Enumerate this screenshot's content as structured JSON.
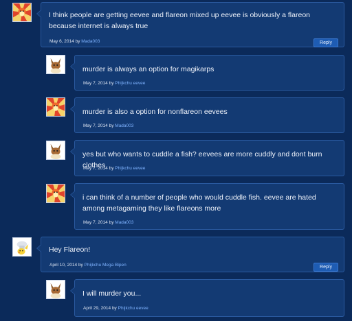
{
  "comments": [
    {
      "avatar": "flareon-avatar",
      "text": "I think people are getting eevee and flareon mixed up eevee is obviously a flareon because internet is always true",
      "date": "May 6, 2014",
      "by": "by",
      "author": "Mada003",
      "reply_label": "Reply"
    },
    {
      "avatar": "eevee-avatar",
      "text": "murder is always an option for magikarps",
      "date": "May 7, 2014",
      "by": "by",
      "author": "Phijkchu eevee"
    },
    {
      "avatar": "flareon-avatar",
      "text": "murder is also a option for nonflareon eevees",
      "date": "May 7, 2014",
      "by": "by",
      "author": "Mada003"
    },
    {
      "avatar": "eevee-avatar",
      "text": "yes but who wants to cuddle a fish? eevees are more cuddly and dont burn clothes",
      "date": "May 7, 2014",
      "by": "by",
      "author": "Phijkchu eevee"
    },
    {
      "avatar": "flareon-avatar",
      "text": "i can think of a number of people who would cuddle fish. eevee are hated among metagaming they like flareons more",
      "date": "May 7, 2014",
      "by": "by",
      "author": "Mada003"
    },
    {
      "avatar": "pikachu-avatar",
      "text": "Hey Flareon!",
      "date": "April 10, 2014",
      "by": "by",
      "author": "Phijkchu Mega Bipen",
      "reply_label": "Reply"
    },
    {
      "avatar": "eevee-avatar",
      "text": "I will murder you...",
      "date": "April 29, 2014",
      "by": "by",
      "author": "Phijkchu eevee"
    }
  ]
}
